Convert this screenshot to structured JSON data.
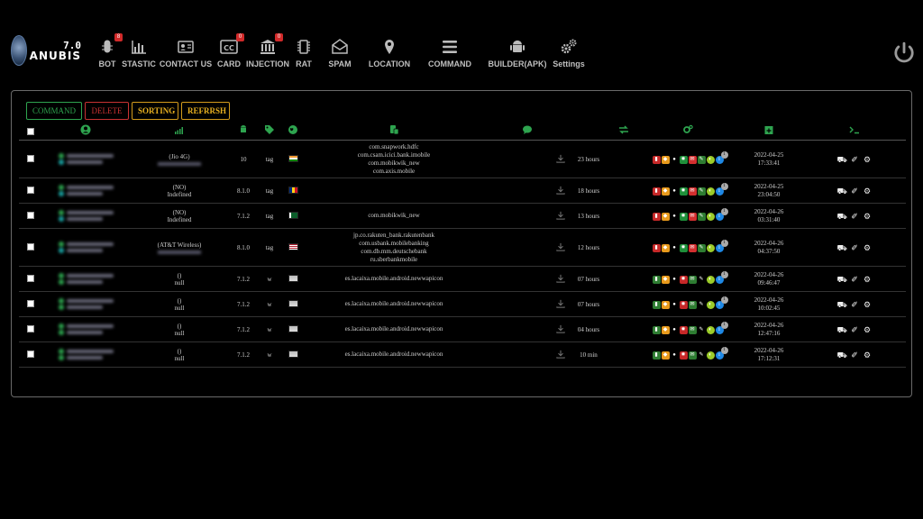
{
  "logo": {
    "version": "7.0",
    "name": "ANUBIS"
  },
  "nav": [
    {
      "id": "bot",
      "label": "BOT",
      "icon": "bug-icon",
      "badge": "8"
    },
    {
      "id": "stastic",
      "label": "STASTIC",
      "icon": "bar-chart-icon",
      "badge": ""
    },
    {
      "id": "contact",
      "label": "CONTACT US",
      "icon": "contact-card-icon",
      "badge": ""
    },
    {
      "id": "card",
      "label": "CARD",
      "icon": "cc-card-icon",
      "badge": "0"
    },
    {
      "id": "injection",
      "label": "INJECTION",
      "icon": "bank-icon",
      "badge": "0"
    },
    {
      "id": "rat",
      "label": "RAT",
      "icon": "chip-icon",
      "badge": ""
    },
    {
      "id": "spam",
      "label": "SPAM",
      "icon": "envelope-icon",
      "badge": ""
    },
    {
      "id": "location",
      "label": "LOCATION",
      "icon": "map-pin-icon",
      "badge": ""
    },
    {
      "id": "command",
      "label": "COMMAND",
      "icon": "menu-icon",
      "badge": ""
    },
    {
      "id": "builder",
      "label": "BUILDER(APK)",
      "icon": "android-icon",
      "badge": ""
    },
    {
      "id": "settings",
      "label": "Settings",
      "icon": "gears-icon",
      "badge": ""
    }
  ],
  "toolbar": {
    "command_label": "COMMAND",
    "delete_label": "DELETE",
    "sorting_label": "SORTING",
    "refresh_label": "REFRRSH"
  },
  "colors": {
    "accent_green": "#2ea44f",
    "danger": "#c83232",
    "warning": "#e8b020",
    "time": "#e8a020"
  },
  "rows": [
    {
      "operator": "(Jio 4G)",
      "android": "10",
      "tag": "tag",
      "flag": "india",
      "apps": [
        "com.snapwork.hdfc",
        "com.csam.icici.bank.imobile",
        "com.mobikwik_new",
        "com.axis.mobile"
      ],
      "last_seen": "23 hours",
      "perm_variant": "red",
      "date": "2022-04-25",
      "time": "17:33:41",
      "num": "1"
    },
    {
      "operator": "(NO)",
      "operator_note": "Indefined",
      "android": "8.1.0",
      "tag": "tag",
      "flag": "romania",
      "apps": [],
      "last_seen": "18 hours",
      "perm_variant": "red",
      "date": "2022-04-25",
      "time": "23:04:50",
      "num": "1"
    },
    {
      "operator": "(NO)",
      "operator_note": "Indefined",
      "android": "7.1.2",
      "tag": "tag",
      "flag": "pakistan",
      "apps": [
        "com.mobikwik_new"
      ],
      "last_seen": "13 hours",
      "perm_variant": "red",
      "date": "2022-04-26",
      "time": "03:31:40",
      "num": "1"
    },
    {
      "operator": "(AT&T Wireless)",
      "android": "8.1.0",
      "tag": "tag",
      "flag": "usa",
      "apps": [
        "jp.co.rakuten_bank.rakutenbank",
        "com.usbank.mobilebanking",
        "com.db.mm.deutschebank",
        "ru.sberbankmobile"
      ],
      "last_seen": "12 hours",
      "perm_variant": "red",
      "date": "2022-04-26",
      "time": "04:37:50",
      "num": "1"
    },
    {
      "operator": "()",
      "operator_note": "null",
      "android": "7.1.2",
      "tag": "w",
      "flag": "unknown",
      "apps": [
        "es.lacaixa.mobile.android.newwapicon"
      ],
      "last_seen": "07 hours",
      "perm_variant": "green",
      "date": "2022-04-26",
      "time": "09:46:47",
      "num": "1"
    },
    {
      "operator": "()",
      "operator_note": "null",
      "android": "7.1.2",
      "tag": "w",
      "flag": "unknown",
      "apps": [
        "es.lacaixa.mobile.android.newwapicon"
      ],
      "last_seen": "07 hours",
      "perm_variant": "green",
      "date": "2022-04-26",
      "time": "10:02:45",
      "num": "1"
    },
    {
      "operator": "()",
      "operator_note": "null",
      "android": "7.1.2",
      "tag": "w",
      "flag": "unknown",
      "apps": [
        "es.lacaixa.mobile.android.newwapicon"
      ],
      "last_seen": "04 hours",
      "perm_variant": "green",
      "date": "2022-04-26",
      "time": "12:47:16",
      "num": "1"
    },
    {
      "operator": "()",
      "operator_note": "null",
      "android": "7.1.2",
      "tag": "w",
      "flag": "unknown",
      "apps": [
        "es.lacaixa.mobile.android.newwapicon"
      ],
      "last_seen": "10 min",
      "perm_variant": "green",
      "date": "2022-04-26",
      "time": "17:12:31",
      "num": "1"
    }
  ]
}
